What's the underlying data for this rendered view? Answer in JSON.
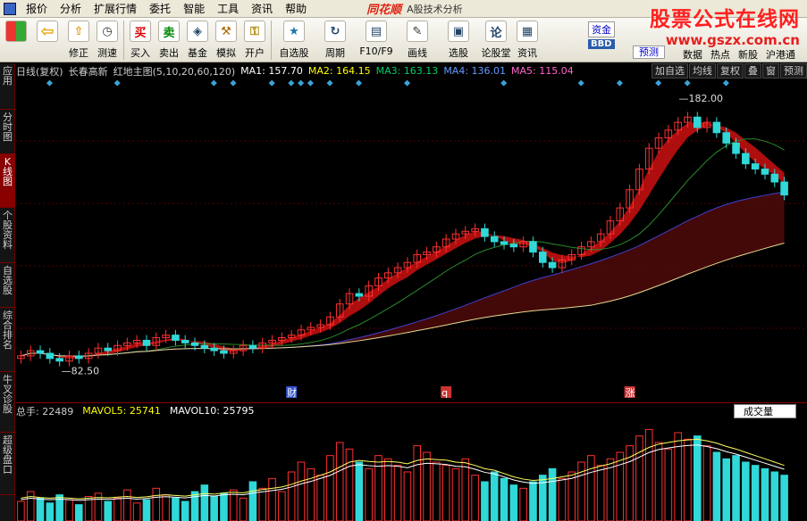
{
  "menu": {
    "items": [
      "报价",
      "分析",
      "扩展行情",
      "委托",
      "智能",
      "工具",
      "资讯",
      "帮助"
    ],
    "brand": "同花顺",
    "brand_sub": "A股技术分析"
  },
  "toolbar": {
    "buttons": [
      {
        "label": "",
        "icon": "grid-icon"
      },
      {
        "label": "",
        "icon": "back-arrow-icon"
      },
      {
        "label": "修正",
        "icon": "up-arrow-icon"
      },
      {
        "label": "测速",
        "icon": "clock-icon"
      },
      {
        "label": "买入",
        "icon": "buy-icon",
        "glyph": "买"
      },
      {
        "label": "卖出",
        "icon": "sell-icon",
        "glyph": "卖"
      },
      {
        "label": "基金",
        "icon": "fund-icon"
      },
      {
        "label": "模拟",
        "icon": "hammer-icon"
      },
      {
        "label": "开户",
        "icon": "lock-icon"
      },
      {
        "label": "自选股",
        "icon": "star-icon"
      },
      {
        "label": "周期",
        "icon": "cycle-icon"
      },
      {
        "label": "F10/F9",
        "icon": "f10-icon"
      },
      {
        "label": "画线",
        "icon": "pencil-icon"
      },
      {
        "label": "选股",
        "icon": "select-icon"
      },
      {
        "label": "论股堂",
        "icon": "forum-icon"
      },
      {
        "label": "资讯",
        "icon": "news-icon"
      }
    ],
    "right_tabs": [
      "资金",
      "BBD",
      "预测"
    ],
    "right_labels": [
      "数据",
      "热点",
      "新股",
      "沪港通"
    ]
  },
  "watermark": {
    "line1": "股票公式在线网",
    "line2": "www.gszx.com.cn"
  },
  "left_tabs": [
    {
      "label": "应用",
      "active": false
    },
    {
      "label": "分时图",
      "active": false
    },
    {
      "label": "K线图",
      "active": true
    },
    {
      "label": "个股资料",
      "active": false
    },
    {
      "label": "自选股",
      "active": false
    },
    {
      "label": "综合排名",
      "active": false
    },
    {
      "label": "牛叉诊股",
      "active": false
    },
    {
      "label": "超级盘口",
      "active": false
    }
  ],
  "info_bar": {
    "period": "日线(复权)",
    "name": "长春高新",
    "indicator": "红地主图(5,10,20,60,120)",
    "ma1": "MA1: 157.70",
    "ma2": "MA2: 164.15",
    "ma3": "MA3: 163.13",
    "ma4": "MA4: 136.01",
    "ma5": "MA5: 115.04",
    "buttons": [
      "加自选",
      "均线",
      "复权",
      "叠",
      "窗",
      "预测"
    ],
    "colors": {
      "ma1": "#ffffff",
      "ma2": "#ffff00",
      "ma3": "#00cc66",
      "ma4": "#6699ff",
      "ma5": "#ff66cc"
    }
  },
  "volume_bar": {
    "total": "总手: 22489",
    "mavol5": "MAVOL5: 25741",
    "mavol10": "MAVOL10: 25795",
    "select": "成交量"
  },
  "chart_data": {
    "type": "candlestick",
    "high_label": "182.00",
    "low_label": "82.50",
    "markers": [
      "财",
      "q",
      "涨"
    ],
    "price_range": [
      78,
      188
    ],
    "close_series": [
      88,
      90,
      89,
      87,
      86,
      88,
      87,
      89,
      91,
      90,
      92,
      93,
      94,
      92,
      95,
      96,
      94,
      93,
      92,
      91,
      90,
      89,
      90,
      92,
      91,
      93,
      94,
      95,
      96,
      98,
      99,
      100,
      103,
      108,
      112,
      111,
      115,
      118,
      120,
      122,
      124,
      127,
      128,
      130,
      133,
      135,
      136,
      137,
      134,
      132,
      131,
      130,
      132,
      128,
      124,
      122,
      125,
      127,
      130,
      132,
      135,
      140,
      145,
      152,
      160,
      168,
      172,
      175,
      178,
      180,
      176,
      178,
      174,
      170,
      166,
      162,
      160,
      158,
      155,
      150
    ],
    "volume_series": [
      60,
      90,
      70,
      55,
      80,
      65,
      50,
      75,
      85,
      60,
      70,
      95,
      55,
      65,
      100,
      80,
      70,
      60,
      90,
      110,
      75,
      85,
      95,
      70,
      120,
      100,
      130,
      90,
      150,
      180,
      160,
      140,
      200,
      240,
      220,
      180,
      160,
      200,
      190,
      170,
      150,
      230,
      210,
      180,
      170,
      160,
      190,
      140,
      120,
      150,
      130,
      110,
      100,
      120,
      140,
      160,
      130,
      150,
      180,
      200,
      170,
      190,
      210,
      230,
      260,
      280,
      240,
      220,
      270,
      250,
      260,
      230,
      210,
      190,
      200,
      180,
      170,
      160,
      150,
      140
    ],
    "mavol_series": [
      70,
      75,
      72,
      70,
      72,
      70,
      68,
      70,
      72,
      71,
      73,
      75,
      72,
      74,
      78,
      80,
      78,
      76,
      80,
      84,
      82,
      86,
      88,
      86,
      92,
      96,
      100,
      104,
      112,
      122,
      130,
      140,
      150,
      165,
      180,
      185,
      182,
      180,
      182,
      180,
      175,
      185,
      190,
      188,
      186,
      180,
      178,
      170,
      160,
      155,
      145,
      135,
      128,
      124,
      126,
      130,
      135,
      140,
      150,
      160,
      168,
      175,
      185,
      195,
      210,
      225,
      235,
      240,
      245,
      248,
      250,
      245,
      238,
      228,
      220,
      210,
      200,
      190,
      180,
      170
    ]
  }
}
